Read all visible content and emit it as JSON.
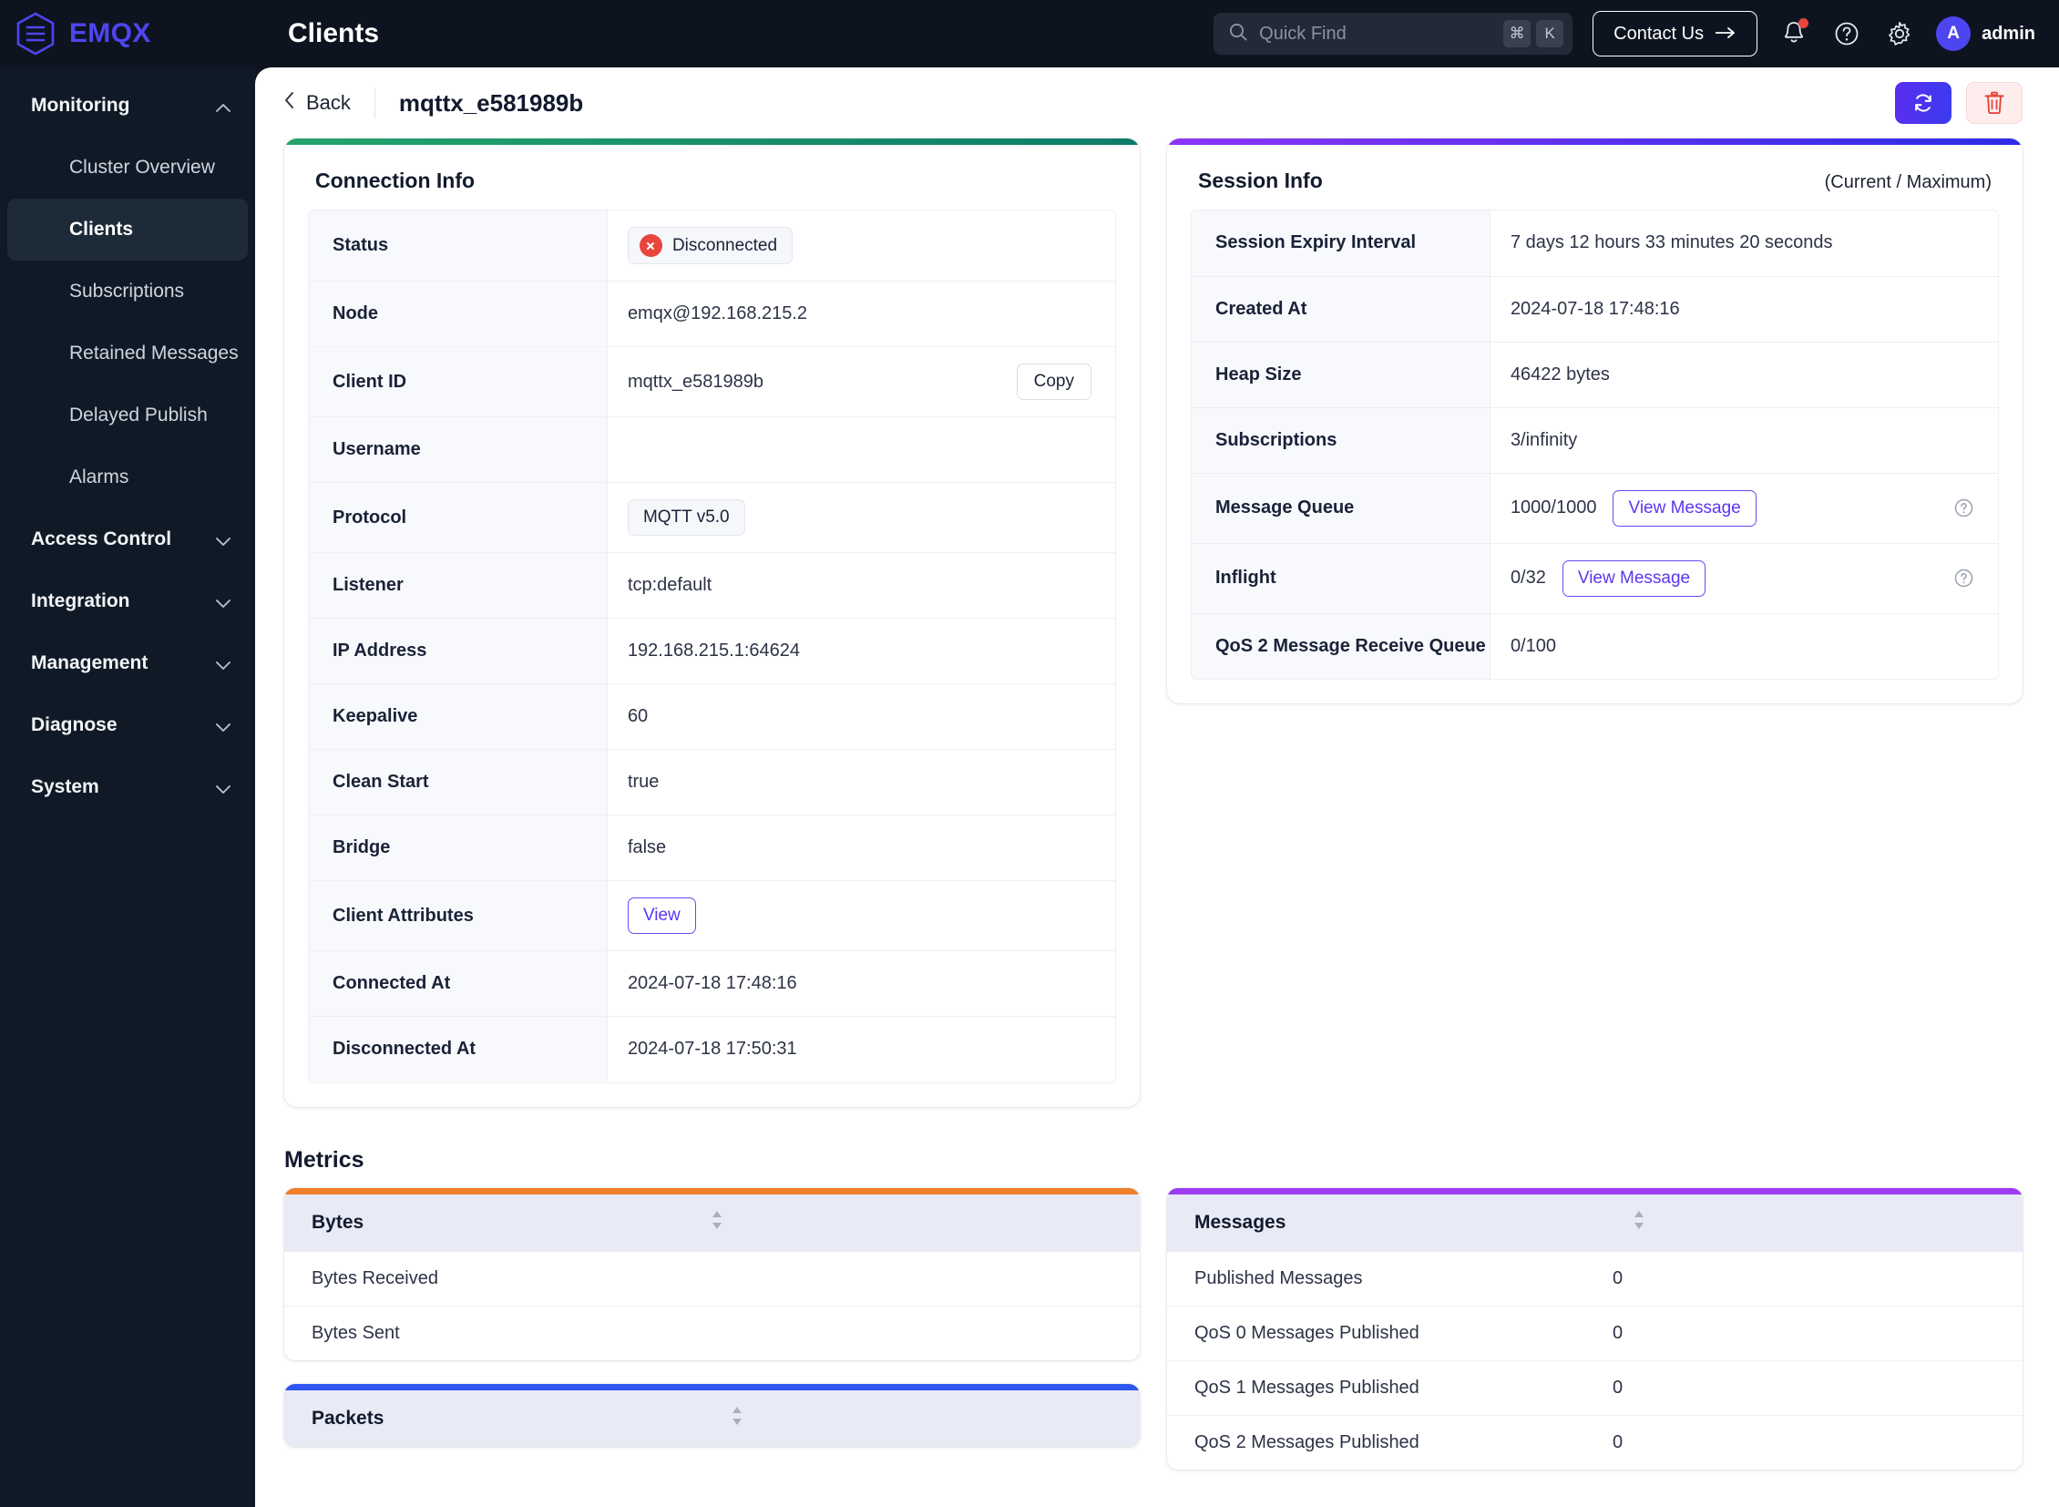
{
  "brand": {
    "name": "EMQX",
    "logo_icon": "emqx-hex-logo-icon"
  },
  "topbar": {
    "title": "Clients",
    "search": {
      "placeholder": "Quick Find",
      "key_cmd": "⌘",
      "key_letter": "K"
    },
    "contact_label": "Contact Us",
    "notifications_icon": "bell-icon",
    "help_icon": "question-circle-icon",
    "settings_icon": "gear-icon",
    "avatar_initial": "A",
    "user_name": "admin"
  },
  "sidebar": {
    "groups": [
      {
        "label": "Monitoring",
        "expanded": true,
        "items": [
          {
            "label": "Cluster Overview",
            "active": false
          },
          {
            "label": "Clients",
            "active": true
          },
          {
            "label": "Subscriptions",
            "active": false
          },
          {
            "label": "Retained Messages",
            "active": false
          },
          {
            "label": "Delayed Publish",
            "active": false
          },
          {
            "label": "Alarms",
            "active": false
          }
        ]
      },
      {
        "label": "Access Control",
        "expanded": false,
        "items": []
      },
      {
        "label": "Integration",
        "expanded": false,
        "items": []
      },
      {
        "label": "Management",
        "expanded": false,
        "items": []
      },
      {
        "label": "Diagnose",
        "expanded": false,
        "items": []
      },
      {
        "label": "System",
        "expanded": false,
        "items": []
      }
    ]
  },
  "page": {
    "back_label": "Back",
    "title": "mqttx_e581989b",
    "refresh_icon": "refresh-icon",
    "delete_icon": "trash-icon"
  },
  "connection_info": {
    "title": "Connection Info",
    "rows": [
      {
        "key": "Status",
        "type": "status",
        "value": "Disconnected",
        "icon": "x-circle-icon"
      },
      {
        "key": "Node",
        "type": "text",
        "value": "emqx@192.168.215.2"
      },
      {
        "key": "Client ID",
        "type": "text-copy",
        "value": "mqttx_e581989b",
        "button": "Copy"
      },
      {
        "key": "Username",
        "type": "text",
        "value": ""
      },
      {
        "key": "Protocol",
        "type": "chip",
        "value": "MQTT v5.0"
      },
      {
        "key": "Listener",
        "type": "text",
        "value": "tcp:default"
      },
      {
        "key": "IP Address",
        "type": "text",
        "value": "192.168.215.1:64624"
      },
      {
        "key": "Keepalive",
        "type": "text",
        "value": "60"
      },
      {
        "key": "Clean Start",
        "type": "text",
        "value": "true"
      },
      {
        "key": "Bridge",
        "type": "text",
        "value": "false"
      },
      {
        "key": "Client Attributes",
        "type": "button-primary",
        "value": "View"
      },
      {
        "key": "Connected At",
        "type": "text",
        "value": "2024-07-18 17:48:16"
      },
      {
        "key": "Disconnected At",
        "type": "text",
        "value": "2024-07-18 17:50:31"
      }
    ]
  },
  "session_info": {
    "title": "Session Info",
    "subtitle": "(Current / Maximum)",
    "rows": [
      {
        "key": "Session Expiry Interval",
        "type": "text",
        "value": "7 days 12 hours 33 minutes 20 seconds"
      },
      {
        "key": "Created At",
        "type": "text",
        "value": "2024-07-18 17:48:16"
      },
      {
        "key": "Heap Size",
        "type": "text",
        "value": "46422 bytes"
      },
      {
        "key": "Subscriptions",
        "type": "text",
        "value": "3/infinity"
      },
      {
        "key": "Message Queue",
        "type": "value-button-help",
        "value": "1000/1000",
        "button": "View Message",
        "help_icon": "question-circle-icon"
      },
      {
        "key": "Inflight",
        "type": "value-button-help",
        "value": "0/32",
        "button": "View Message",
        "help_icon": "question-circle-icon"
      },
      {
        "key": "QoS 2 Message Receive Queue",
        "type": "text",
        "value": "0/100"
      }
    ]
  },
  "metrics": {
    "title": "Metrics",
    "sort_icon": "sort-updown-icon",
    "cards": [
      {
        "title": "Bytes",
        "accent": "orange",
        "rows": [
          {
            "label": "Bytes Received",
            "value": ""
          },
          {
            "label": "Bytes Sent",
            "value": ""
          }
        ]
      },
      {
        "title": "Packets",
        "accent": "blue",
        "rows": []
      },
      {
        "title": "Messages",
        "accent": "violet",
        "rows": [
          {
            "label": "Published Messages",
            "value": "0"
          },
          {
            "label": "QoS 0 Messages Published",
            "value": "0"
          },
          {
            "label": "QoS 1 Messages Published",
            "value": "0"
          },
          {
            "label": "QoS 2 Messages Published",
            "value": "0"
          }
        ]
      }
    ]
  },
  "colors": {
    "brand_purple": "#4d46f0",
    "sidebar_bg": "#101a27",
    "topbar_bg": "#0d1420",
    "accent_green": "#24a36b",
    "accent_purple": "#8b35f5",
    "accent_orange": "#ef7f28",
    "accent_blue": "#2f56f0",
    "accent_violet": "#9c3bf0",
    "danger_red": "#e8453c"
  }
}
